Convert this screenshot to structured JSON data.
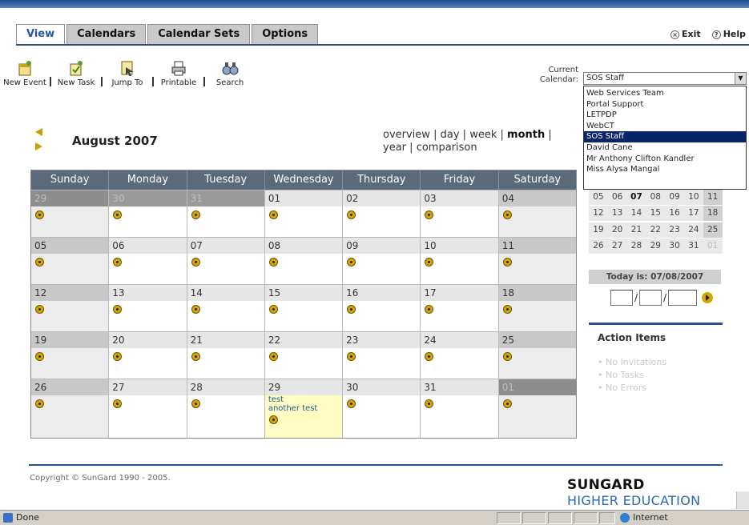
{
  "tabs": [
    "View",
    "Calendars",
    "Calendar Sets",
    "Options"
  ],
  "top_links": {
    "exit": "Exit",
    "help": "Help"
  },
  "toolbar": [
    "New Event",
    "New Task",
    "Jump To",
    "Printable",
    "Search"
  ],
  "current_calendar": {
    "label": "Current Calendar:",
    "value": "SOS Staff",
    "options": [
      "Web Services Team",
      "Portal Support",
      "LETPDP",
      "WebCT",
      "SOS Staff",
      "David Cane",
      "Mr Anthony Clifton Kandler",
      "Miss Alysa Mangal"
    ]
  },
  "month_title": "August 2007",
  "views": {
    "overview": "overview",
    "day": "day",
    "week": "week",
    "month": "month",
    "year": "year",
    "comparison": "comparison",
    "sep": "|"
  },
  "weekdays": [
    "Sunday",
    "Monday",
    "Tuesday",
    "Wednesday",
    "Thursday",
    "Friday",
    "Saturday"
  ],
  "weeks": [
    [
      "29",
      "30",
      "31",
      "01",
      "02",
      "03",
      "04"
    ],
    [
      "05",
      "06",
      "07",
      "08",
      "09",
      "10",
      "11"
    ],
    [
      "12",
      "13",
      "14",
      "15",
      "16",
      "17",
      "18"
    ],
    [
      "19",
      "20",
      "21",
      "22",
      "23",
      "24",
      "25"
    ],
    [
      "26",
      "27",
      "28",
      "29",
      "30",
      "31",
      "01"
    ]
  ],
  "events": {
    "event1": "test",
    "event2": "another test"
  },
  "mini_calendar": [
    [
      "05",
      "06",
      "07",
      "08",
      "09",
      "10",
      "11"
    ],
    [
      "12",
      "13",
      "14",
      "15",
      "16",
      "17",
      "18"
    ],
    [
      "19",
      "20",
      "21",
      "22",
      "23",
      "24",
      "25"
    ],
    [
      "26",
      "27",
      "28",
      "29",
      "30",
      "31",
      "01"
    ]
  ],
  "today_text": "Today is: 07/08/2007",
  "date_slash": "/",
  "action_items": {
    "title": "Action Items",
    "items": [
      "No Invitations",
      "No Tasks",
      "No Errors"
    ]
  },
  "copyright": "Copyright © SunGard 1990 - 2005.",
  "logo": {
    "line1": "SUNGARD",
    "line2": "HIGHER EDUCATION"
  },
  "status": {
    "done": "Done",
    "zone": "Internet"
  }
}
